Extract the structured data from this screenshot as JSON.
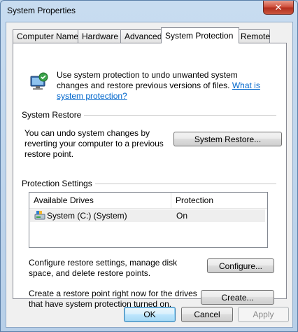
{
  "window": {
    "title": "System Properties",
    "close_glyph": "✕"
  },
  "tabs": [
    {
      "label": "Computer Name"
    },
    {
      "label": "Hardware"
    },
    {
      "label": "Advanced"
    },
    {
      "label": "System Protection"
    },
    {
      "label": "Remote"
    }
  ],
  "intro": {
    "text": "Use system protection to undo unwanted system changes and restore previous versions of files. ",
    "link": "What is system protection?"
  },
  "system_restore": {
    "group_label": "System Restore",
    "description": "You can undo system changes by reverting your computer to a previous restore point.",
    "button_label": "System Restore..."
  },
  "protection_settings": {
    "group_label": "Protection Settings",
    "columns": [
      "Available Drives",
      "Protection"
    ],
    "rows": [
      {
        "drive": "System (C:) (System)",
        "protection": "On",
        "icon": "drive-icon"
      }
    ],
    "configure_text": "Configure restore settings, manage disk space, and delete restore points.",
    "configure_button": "Configure...",
    "create_text": "Create a restore point right now for the drives that have system protection turned on.",
    "create_button": "Create..."
  },
  "footer": {
    "ok": "OK",
    "cancel": "Cancel",
    "apply": "Apply"
  },
  "colors": {
    "link": "#0066cc",
    "selected_row": "#eeeeee",
    "close_button": "#c9543d"
  }
}
